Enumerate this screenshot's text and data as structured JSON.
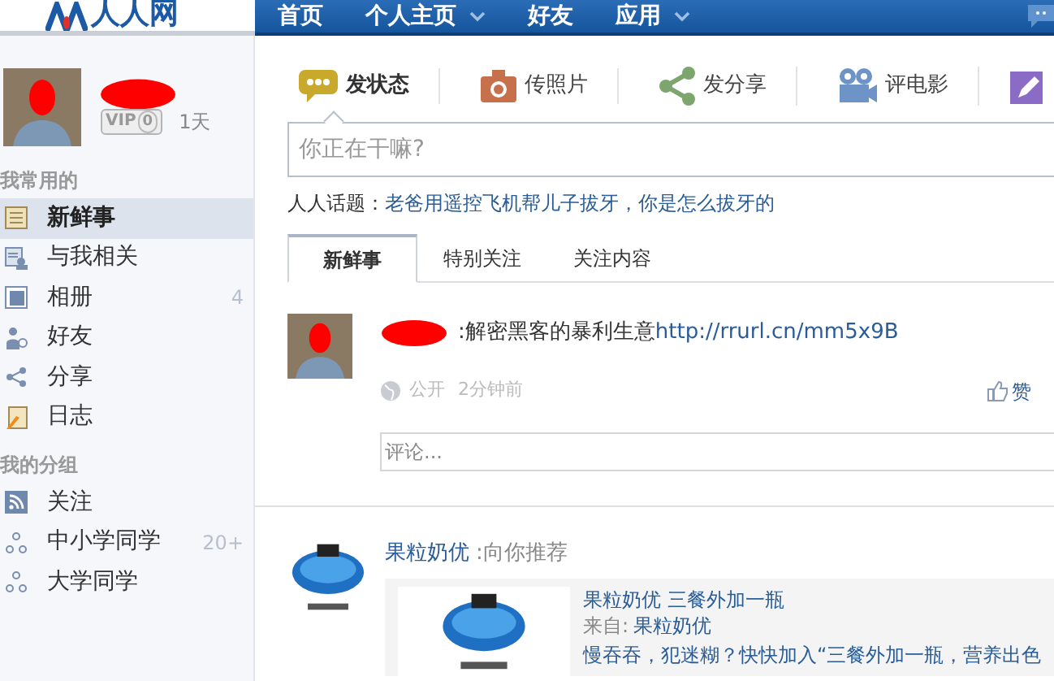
{
  "header": {
    "logo": "人人网",
    "nav": [
      {
        "label": "首页",
        "dropdown": false
      },
      {
        "label": "个人主页",
        "dropdown": true
      },
      {
        "label": "好友",
        "dropdown": false
      },
      {
        "label": "应用",
        "dropdown": true
      }
    ]
  },
  "profile": {
    "vip": "VIP",
    "vip_level": "0",
    "days": "1天"
  },
  "sidebar": {
    "sections": [
      {
        "title": "我常用的",
        "items": [
          {
            "label": "新鲜事",
            "selected": true
          },
          {
            "label": "与我相关",
            "selected": false
          },
          {
            "label": "相册",
            "count": "4",
            "selected": false
          },
          {
            "label": "好友",
            "selected": false
          },
          {
            "label": "分享",
            "selected": false
          },
          {
            "label": "日志",
            "selected": false
          }
        ]
      },
      {
        "title": "我的分组",
        "items": [
          {
            "label": "关注",
            "selected": false
          },
          {
            "label": "中小学同学",
            "count": "20+",
            "selected": false
          },
          {
            "label": "大学同学",
            "selected": false
          }
        ]
      }
    ]
  },
  "composer": {
    "actions": [
      {
        "label": "发状态",
        "selected": true
      },
      {
        "label": "传照片",
        "selected": false
      },
      {
        "label": "发分享",
        "selected": false
      },
      {
        "label": "评电影",
        "selected": false
      }
    ],
    "placeholder": "你正在干嘛?",
    "topic_label": "人人话题：",
    "topic_link": "老爸用遥控飞机帮儿子拔牙，你是怎么拔牙的"
  },
  "feed_tabs": [
    {
      "label": "新鲜事",
      "selected": true
    },
    {
      "label": "特别关注",
      "selected": false
    },
    {
      "label": "关注内容",
      "selected": false
    }
  ],
  "post": {
    "text": ":解密黑客的暴利生意",
    "link": "http://rrurl.cn/mm5x9B",
    "privacy": "公开",
    "time": "2分钟前",
    "like": "赞",
    "comment_placeholder": "评论..."
  },
  "ad": {
    "brand": "果粒奶优",
    "suffix": ":向你推荐",
    "title": "果粒奶优 三餐外加一瓶",
    "from_label": "来自:",
    "from": "果粒奶优",
    "description": "慢吞吞，犯迷糊？快快加入“三餐外加一瓶，营养出色"
  }
}
